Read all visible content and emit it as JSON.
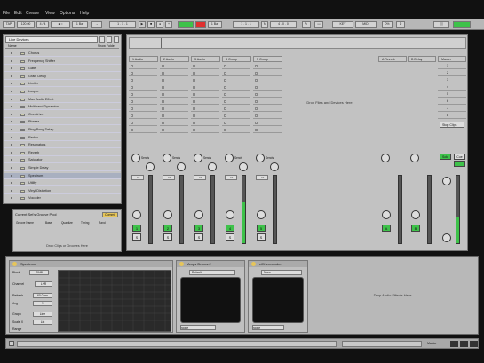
{
  "menu": [
    "File",
    "Edit",
    "Create",
    "View",
    "Options",
    "Help"
  ],
  "transport": {
    "tempo": "120.00",
    "signature": "4 / 4",
    "bar_position": "1 . 1 . 1",
    "quantize": "1 Bar",
    "key_label": "KEY",
    "midi_label": "MIDI"
  },
  "browser": {
    "title": "Live Devices",
    "name_header": "Name",
    "sort_label": "Show Folder",
    "items": [
      "Chorus",
      "Frequency Shifter",
      "Gate",
      "Grain Delay",
      "Limiter",
      "Looper",
      "Max Audio Effect",
      "Multiband Dynamics",
      "Overdrive",
      "Phaser",
      "Ping Pong Delay",
      "Redux",
      "Resonators",
      "Reverb",
      "Saturator",
      "Simple Delay",
      "Spectrum",
      "Utility",
      "Vinyl Distortion",
      "Vocoder"
    ],
    "selected": "Spectrum"
  },
  "grooves": {
    "title": "Current Set's Groove Pool",
    "commit_label": "Commit",
    "columns": [
      "Groove Name",
      "Base",
      "Quantize",
      "Timing",
      "Rand"
    ],
    "drop_hint": "Drop Clips or Grooves Here"
  },
  "session": {
    "tracks": [
      {
        "name": "1 Audio",
        "color": "#c8c8c8",
        "number": "1",
        "meter": 0
      },
      {
        "name": "2 Audio",
        "color": "#c8c8c8",
        "number": "2",
        "meter": 0
      },
      {
        "name": "3 Audio",
        "color": "#c8c8c8",
        "number": "3",
        "meter": 0
      },
      {
        "name": "4 Group",
        "color": "#c8c8c8",
        "number": "4",
        "meter": 0.6
      },
      {
        "name": "5 Group",
        "color": "#c8c8c8",
        "number": "5",
        "meter": 0
      }
    ],
    "returns": [
      {
        "name": "A Reverb",
        "letter": "A"
      },
      {
        "name": "B Delay",
        "letter": "B"
      }
    ],
    "master": {
      "name": "Master",
      "scenes": [
        "1",
        "2",
        "3",
        "4",
        "5",
        "6",
        "7",
        "8"
      ],
      "stop_label": "Stop Clips",
      "solo_label": "Solo",
      "cue_label": "Cue"
    },
    "drop_hint": "Drop Files and Devices Here",
    "sends_label": "Sends",
    "db": "-inf"
  },
  "devices": {
    "spectrum": {
      "title": "Spectrum",
      "block_label": "Block",
      "block_value": "2048",
      "channel_label": "Channel",
      "channel_value": "L+R",
      "refresh_label": "Refresh",
      "refresh_value": "60.0 ms",
      "avg_label": "Avg",
      "avg_value": "1",
      "graph_label": "Graph",
      "graph_value": "Line",
      "scale_x_label": "Scale X",
      "scale_x_value": "Lin",
      "range_label": "Range"
    },
    "drum": {
      "title": "Amps Drums-2",
      "default_label": "Default",
      "none_label": "None"
    },
    "external": {
      "title": "efftherecorder",
      "default_label": "Default",
      "none_label": "None"
    },
    "drop_hint": "Drop Audio Effects Here"
  },
  "colors": {
    "accent_green": "#3ec24a",
    "record_red": "#e0302f",
    "panel": "#c2c2c2"
  }
}
